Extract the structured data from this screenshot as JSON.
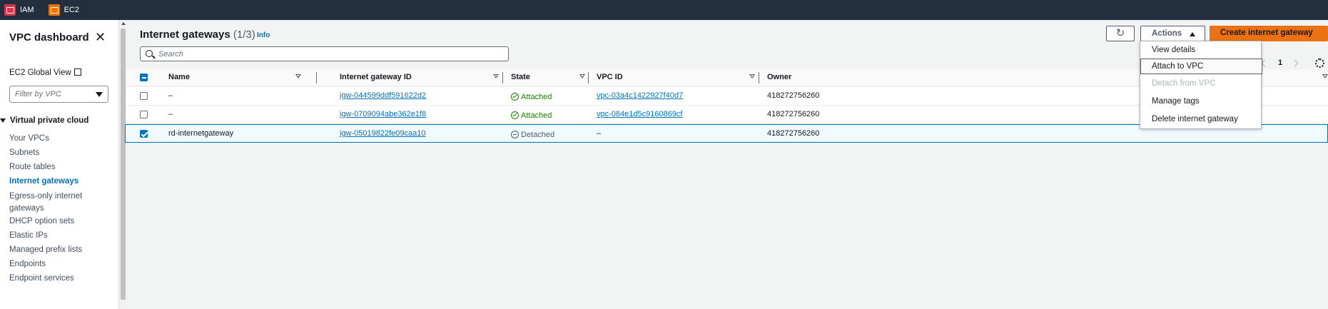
{
  "topbar": {
    "services": [
      {
        "label": "IAM",
        "icon": "iam-icon",
        "color": "#dd344c"
      },
      {
        "label": "EC2",
        "icon": "ec2-icon",
        "color": "#ed7100"
      }
    ]
  },
  "sidebar": {
    "title": "VPC dashboard",
    "close_icon": "close-icon",
    "global_view_label": "EC2 Global View",
    "filter_placeholder": "Filter by VPC",
    "section_label": "Virtual private cloud",
    "items": [
      {
        "label": "Your VPCs",
        "active": false
      },
      {
        "label": "Subnets",
        "active": false
      },
      {
        "label": "Route tables",
        "active": false
      },
      {
        "label": "Internet gateways",
        "active": true
      },
      {
        "label": "Egress-only internet gateways",
        "active": false
      },
      {
        "label": "DHCP option sets",
        "active": false
      },
      {
        "label": "Elastic IPs",
        "active": false
      },
      {
        "label": "Managed prefix lists",
        "active": false
      },
      {
        "label": "Endpoints",
        "active": false
      },
      {
        "label": "Endpoint services",
        "active": false
      }
    ]
  },
  "main": {
    "title": "Internet gateways",
    "count": "(1/3)",
    "info_label": "Info",
    "search_placeholder": "Search",
    "actions_label": "Actions",
    "create_label": "Create internet gateway",
    "page_number": "1",
    "accent_color": "#0073bb",
    "primary_button_color": "#ec7211"
  },
  "table": {
    "columns": [
      "Name",
      "Internet gateway ID",
      "State",
      "VPC ID",
      "Owner"
    ],
    "rows": [
      {
        "name": "–",
        "gateway_id": "igw-044599ddf591622d2",
        "state": "Attached",
        "vpc_id": "vpc-03a4c1422927f40d7",
        "owner": "418272756260",
        "selected": false
      },
      {
        "name": "–",
        "gateway_id": "igw-0709094abe362e1f8",
        "state": "Attached",
        "vpc_id": "vpc-084e1d5c9160869cf",
        "owner": "418272756260",
        "selected": false
      },
      {
        "name": "rd-internetgateway",
        "gateway_id": "igw-05019822fe09caa10",
        "state": "Detached",
        "vpc_id": "–",
        "owner": "418272756260",
        "selected": true
      }
    ]
  },
  "actions_menu": {
    "items": [
      {
        "label": "View details",
        "disabled": false,
        "hover": false
      },
      {
        "label": "Attach to VPC",
        "disabled": false,
        "hover": true
      },
      {
        "label": "Detach from VPC",
        "disabled": true,
        "hover": false
      },
      {
        "label": "Manage tags",
        "disabled": false,
        "hover": false
      },
      {
        "label": "Delete internet gateway",
        "disabled": false,
        "hover": false
      }
    ]
  }
}
